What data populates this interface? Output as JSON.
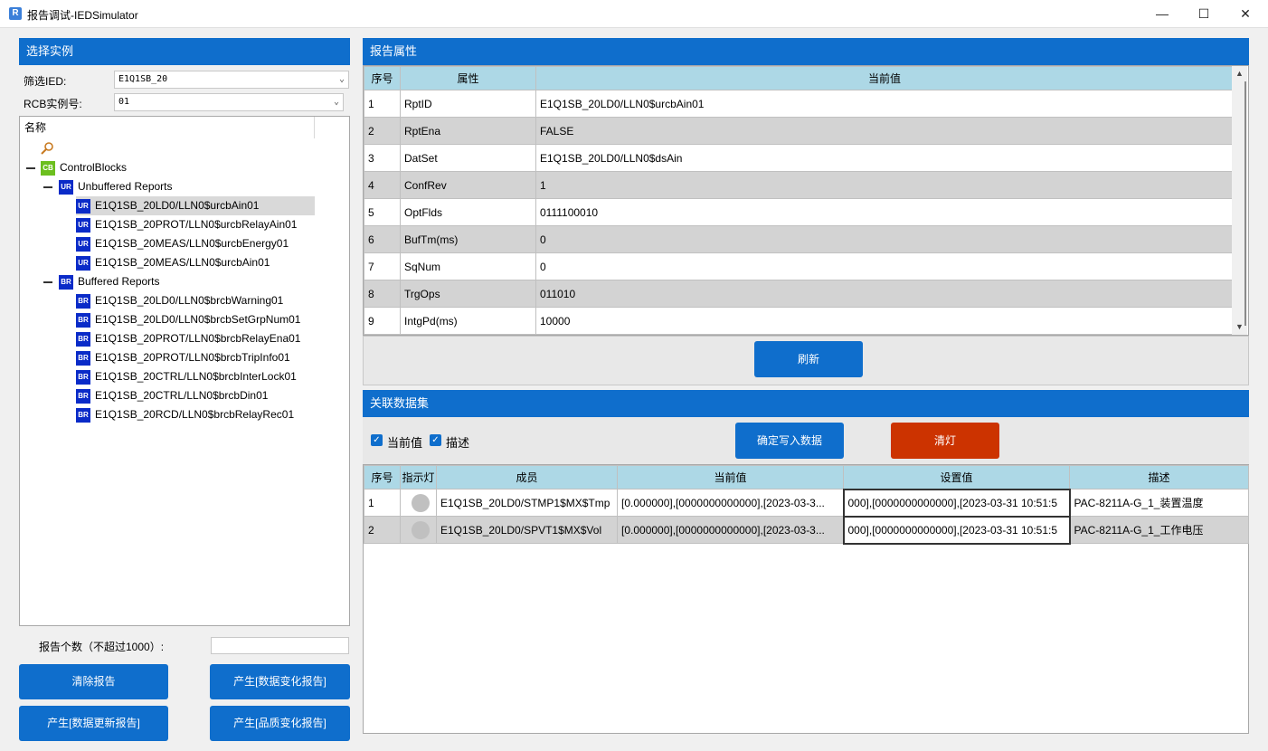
{
  "window": {
    "title": "报告调试-IEDSimulator",
    "app_icon": "R",
    "minimize": "—",
    "maximize": "☐",
    "close": "✕"
  },
  "left": {
    "header": "选择实例",
    "filter_label": "筛选IED:",
    "filter_value": "E1Q1SB_20",
    "rcb_label": "RCB实例号:",
    "rcb_value": "01",
    "tree_header": "名称",
    "tree": {
      "root": "ControlBlocks",
      "root_badge": "CB",
      "ur_group": "Unbuffered Reports",
      "ur_badge": "UR",
      "ur_items": [
        "E1Q1SB_20LD0/LLN0$urcbAin01",
        "E1Q1SB_20PROT/LLN0$urcbRelayAin01",
        "E1Q1SB_20MEAS/LLN0$urcbEnergy01",
        "E1Q1SB_20MEAS/LLN0$urcbAin01"
      ],
      "br_group": "Buffered Reports",
      "br_badge": "BR",
      "br_items": [
        "E1Q1SB_20LD0/LLN0$brcbWarning01",
        "E1Q1SB_20LD0/LLN0$brcbSetGrpNum01",
        "E1Q1SB_20PROT/LLN0$brcbRelayEna01",
        "E1Q1SB_20PROT/LLN0$brcbTripInfo01",
        "E1Q1SB_20CTRL/LLN0$brcbInterLock01",
        "E1Q1SB_20CTRL/LLN0$brcbDin01",
        "E1Q1SB_20RCD/LLN0$brcbRelayRec01"
      ]
    },
    "count_label": "报告个数（不超过1000）:",
    "count_value": "",
    "btn_clear": "清除报告",
    "btn_data_change": "产生[数据变化报告]",
    "btn_data_update": "产生[数据更新报告]",
    "btn_quality_change": "产生[品质变化报告]"
  },
  "report_attrs": {
    "header": "报告属性",
    "columns": [
      "序号",
      "属性",
      "当前值"
    ],
    "rows": [
      [
        "1",
        "RptID",
        "E1Q1SB_20LD0/LLN0$urcbAin01"
      ],
      [
        "2",
        "RptEna",
        "FALSE"
      ],
      [
        "3",
        "DatSet",
        "E1Q1SB_20LD0/LLN0$dsAin"
      ],
      [
        "4",
        "ConfRev",
        "1"
      ],
      [
        "5",
        "OptFlds",
        "0111100010"
      ],
      [
        "6",
        "BufTm(ms)",
        "0"
      ],
      [
        "7",
        "SqNum",
        "0"
      ],
      [
        "8",
        "TrgOps",
        "011010"
      ],
      [
        "9",
        "IntgPd(ms)",
        "10000"
      ]
    ],
    "refresh_btn": "刷新"
  },
  "dataset": {
    "header": "关联数据集",
    "check_current": "当前值",
    "check_desc": "描述",
    "confirm_btn": "确定写入数据",
    "clear_btn": "清灯",
    "columns": [
      "序号",
      "指示灯",
      "成员",
      "当前值",
      "设置值",
      "描述"
    ],
    "rows": [
      [
        "1",
        "",
        "E1Q1SB_20LD0/STMP1$MX$Tmp",
        "[0.000000],[0000000000000],[2023-03-3...",
        "000],[0000000000000],[2023-03-31 10:51:5",
        "PAC-8211A-G_1_装置温度"
      ],
      [
        "2",
        "",
        "E1Q1SB_20LD0/SPVT1$MX$Vol",
        "[0.000000],[0000000000000],[2023-03-3...",
        "000],[0000000000000],[2023-03-31 10:51:5",
        "PAC-8211A-G_1_工作电压"
      ]
    ]
  }
}
